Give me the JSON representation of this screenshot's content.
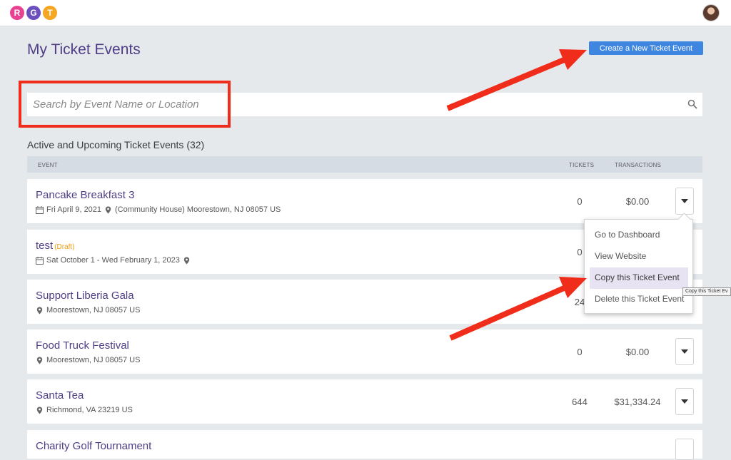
{
  "app": {
    "logo_letters": [
      {
        "letter": "R",
        "color": "#e84393"
      },
      {
        "letter": "G",
        "color": "#6c4fbf"
      },
      {
        "letter": "T",
        "color": "#f5a623"
      }
    ]
  },
  "header": {
    "title": "My Ticket Events",
    "create_button": "Create a New Ticket Event"
  },
  "search": {
    "placeholder": "Search by Event Name or Location"
  },
  "section": {
    "heading": "Active and Upcoming Ticket Events (32)"
  },
  "table": {
    "columns": {
      "event": "EVENT",
      "tickets": "TICKETS",
      "transactions": "TRANSACTIONS"
    },
    "rows": [
      {
        "name": "Pancake Breakfast 3",
        "draft": "",
        "date": "Fri April 9, 2021",
        "location": "(Community House) Moorestown, NJ 08057 US",
        "tickets": "0",
        "transactions": "$0.00"
      },
      {
        "name": "test",
        "draft": "(Draft)",
        "date": "Sat October 1 - Wed February 1, 2023",
        "location": "",
        "tickets": "0",
        "transactions": ""
      },
      {
        "name": "Support Liberia Gala",
        "draft": "",
        "date": "",
        "location": "Moorestown, NJ 08057 US",
        "tickets": "24",
        "transactions": ""
      },
      {
        "name": "Food Truck Festival",
        "draft": "",
        "date": "",
        "location": "Moorestown, NJ 08057 US",
        "tickets": "0",
        "transactions": "$0.00"
      },
      {
        "name": "Santa Tea",
        "draft": "",
        "date": "",
        "location": "Richmond, VA 23219 US",
        "tickets": "644",
        "transactions": "$31,334.24"
      },
      {
        "name": "Charity Golf Tournament",
        "draft": "",
        "date": "",
        "location": "",
        "tickets": "",
        "transactions": ""
      }
    ]
  },
  "dropdown_menu": {
    "items": [
      "Go to Dashboard",
      "View Website",
      "Copy this Ticket Event",
      "Delete this Ticket Event"
    ],
    "active_index": 2
  },
  "tooltip": {
    "text": "Copy this Ticket Ev"
  },
  "colors": {
    "accent": "#3f86e0",
    "title": "#4f3d86",
    "annotation": "#f02d1b",
    "draft": "#f39c12"
  }
}
